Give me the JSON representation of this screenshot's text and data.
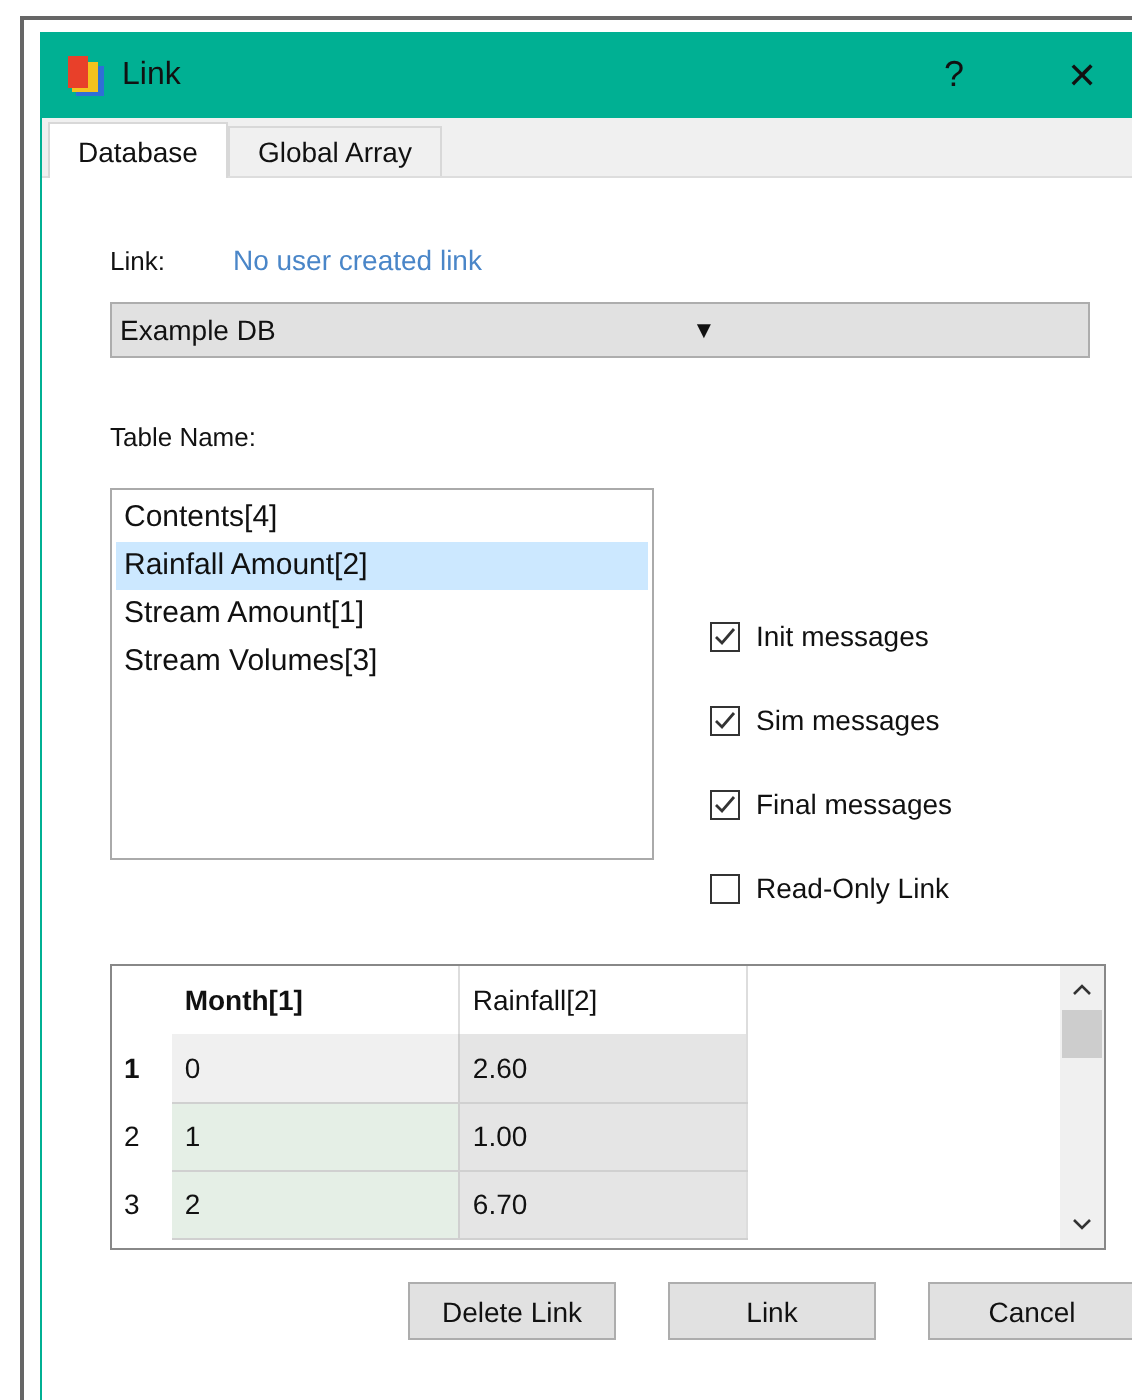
{
  "window": {
    "title": "Link",
    "help": "?",
    "close": "✕"
  },
  "tabs": [
    {
      "label": "Database",
      "selected": true
    },
    {
      "label": "Global Array",
      "selected": false
    }
  ],
  "link": {
    "label": "Link:",
    "value": "No user created link"
  },
  "database_dropdown": {
    "value": "Example DB",
    "arrow": "▼"
  },
  "table_name_label": "Table Name:",
  "tables": [
    {
      "label": "Contents[4]",
      "selected": false
    },
    {
      "label": "Rainfall Amount[2]",
      "selected": true
    },
    {
      "label": "Stream Amount[1]",
      "selected": false
    },
    {
      "label": "Stream Volumes[3]",
      "selected": false
    }
  ],
  "options": [
    {
      "label": "Init messages",
      "checked": true
    },
    {
      "label": "Sim messages",
      "checked": true
    },
    {
      "label": "Final messages",
      "checked": true
    },
    {
      "label": "Read-Only Link",
      "checked": false
    }
  ],
  "table": {
    "columns": [
      {
        "label": "Month[1]",
        "selected": true
      },
      {
        "label": "Rainfall[2]",
        "selected": false
      }
    ],
    "rows": [
      {
        "number": "1",
        "selected": true,
        "cells": [
          "0",
          "2.60"
        ]
      },
      {
        "number": "2",
        "selected": false,
        "cells": [
          "1",
          "1.00"
        ]
      },
      {
        "number": "3",
        "selected": false,
        "cells": [
          "2",
          "6.70"
        ]
      }
    ]
  },
  "buttons": [
    "Delete Link",
    "Link",
    "Cancel"
  ]
}
